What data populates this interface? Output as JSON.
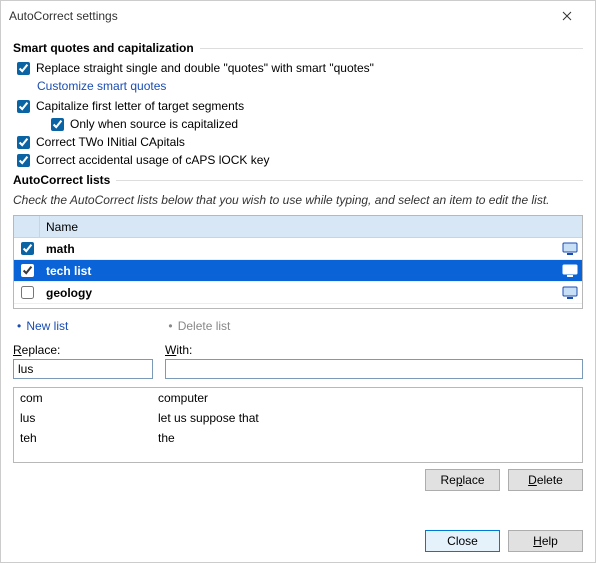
{
  "title": "AutoCorrect settings",
  "group1": "Smart quotes and capitalization",
  "opt_smartquotes": "Replace straight single and double \"quotes\" with smart \"quotes\"",
  "link_customize": "Customize smart quotes",
  "opt_capfirst": "Capitalize first letter of target segments",
  "opt_onlywhen": "Only when source is capitalized",
  "opt_twocaps": "Correct TWo INitial CApitals",
  "opt_capslock": "Correct accidental usage of cAPS lOCK key",
  "group2": "AutoCorrect lists",
  "hint": "Check the AutoCorrect lists below that you wish to use while typing, and select an item to edit the list.",
  "col_name": "Name",
  "lists": [
    {
      "name": "math",
      "checked": true,
      "selected": false
    },
    {
      "name": "tech list",
      "checked": true,
      "selected": true
    },
    {
      "name": "geology",
      "checked": false,
      "selected": false
    }
  ],
  "action_new": "New list",
  "action_delete": "Delete list",
  "label_replace": "Replace:",
  "label_with": "With:",
  "input_replace": "lus",
  "input_with": "",
  "replacements": [
    {
      "from": "com",
      "to": "computer"
    },
    {
      "from": "lus",
      "to": "let us suppose that"
    },
    {
      "from": "teh",
      "to": "the"
    }
  ],
  "btn_replace": "Replace",
  "btn_delete": "Delete",
  "btn_close": "Close",
  "btn_help": "Help"
}
